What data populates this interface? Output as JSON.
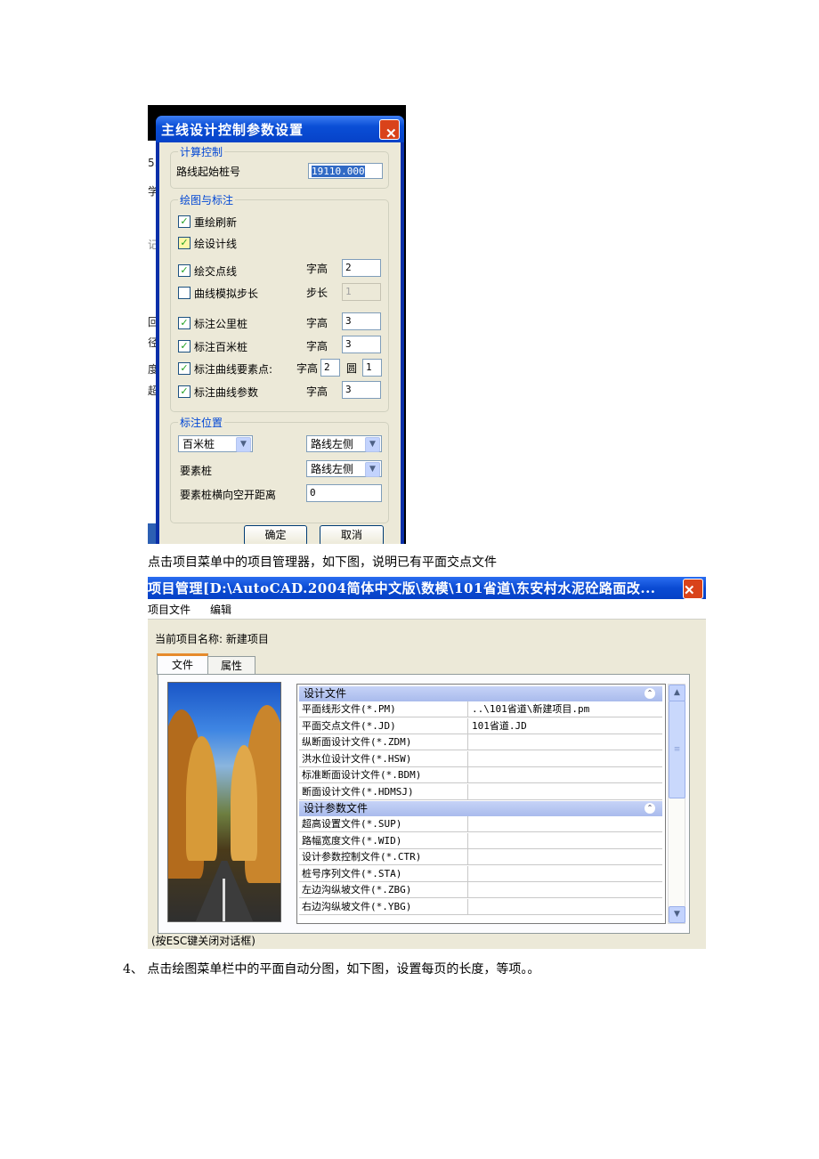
{
  "dialog1": {
    "title": "主线设计控制参数设置",
    "group_calc": {
      "legend": "计算控制",
      "start_station_label": "路线起始桩号",
      "start_station_value": "19110.000"
    },
    "group_draw": {
      "legend": "绘图与标注",
      "redraw_label": "重绘刷新",
      "redraw_checked": true,
      "design_line_label": "绘设计线",
      "design_line_checked": true,
      "intersection_line_label": "绘交点线",
      "intersection_line_checked": true,
      "intersection_height_label": "字高",
      "intersection_height_value": "2",
      "curve_step_label": "曲线模拟步长",
      "curve_step_checked": false,
      "step_label": "步长",
      "step_value": "1",
      "km_label": "标注公里桩",
      "km_checked": true,
      "km_height_label": "字高",
      "km_height_value": "3",
      "hm_label": "标注百米桩",
      "hm_checked": true,
      "hm_height_label": "字高",
      "hm_height_value": "3",
      "curve_points_label": "标注曲线要素点:",
      "curve_points_checked": true,
      "curve_points_height_label": "字高",
      "curve_points_height_value": "2",
      "circle_label": "圆",
      "circle_value": "1",
      "curve_params_label": "标注曲线参数",
      "curve_params_checked": true,
      "curve_params_height_label": "字高",
      "curve_params_height_value": "3"
    },
    "group_position": {
      "legend": "标注位置",
      "hm_station_select": "百米桩",
      "hm_side_select": "路线左侧",
      "element_station_label": "要素桩",
      "element_side_select": "路线左侧",
      "offset_label": "要素桩横向空开距离",
      "offset_value": "0"
    },
    "ok_label": "确定",
    "cancel_label": "取消",
    "background_fragments": [
      "5.",
      "学",
      "记",
      "回",
      "径",
      "度",
      "超"
    ]
  },
  "caption1": "点击项目菜单中的项目管理器，如下图，说明已有平面交点文件",
  "dialog2": {
    "title": "项目管理[D:\\AutoCAD.2004简体中文版\\数模\\101省道\\东安村水泥砼路面改...",
    "menu": [
      "项目文件",
      "编辑"
    ],
    "project_name_label": "当前项目名称: 新建项目",
    "tabs": [
      "文件",
      "属性"
    ],
    "sections": [
      {
        "header": "设计文件",
        "rows": [
          {
            "name": "平面线形文件(*.PM)",
            "value": "..\\101省道\\新建项目.pm"
          },
          {
            "name": "平面交点文件(*.JD)",
            "value": "101省道.JD"
          },
          {
            "name": "纵断面设计文件(*.ZDM)",
            "value": ""
          },
          {
            "name": "洪水位设计文件(*.HSW)",
            "value": ""
          },
          {
            "name": "标准断面设计文件(*.BDM)",
            "value": ""
          },
          {
            "name": "断面设计文件(*.HDMSJ)",
            "value": ""
          }
        ]
      },
      {
        "header": "设计参数文件",
        "rows": [
          {
            "name": "超高设置文件(*.SUP)",
            "value": ""
          },
          {
            "name": "路幅宽度文件(*.WID)",
            "value": ""
          },
          {
            "name": "设计参数控制文件(*.CTR)",
            "value": ""
          },
          {
            "name": "桩号序列文件(*.STA)",
            "value": ""
          },
          {
            "name": "左边沟纵坡文件(*.ZBG)",
            "value": ""
          },
          {
            "name": "右边沟纵坡文件(*.YBG)",
            "value": ""
          }
        ]
      }
    ],
    "footer": "(按ESC键关闭对话框)"
  },
  "caption2": "4、 点击绘图菜单栏中的平面自动分图，如下图，设置每页的长度，等项。。"
}
